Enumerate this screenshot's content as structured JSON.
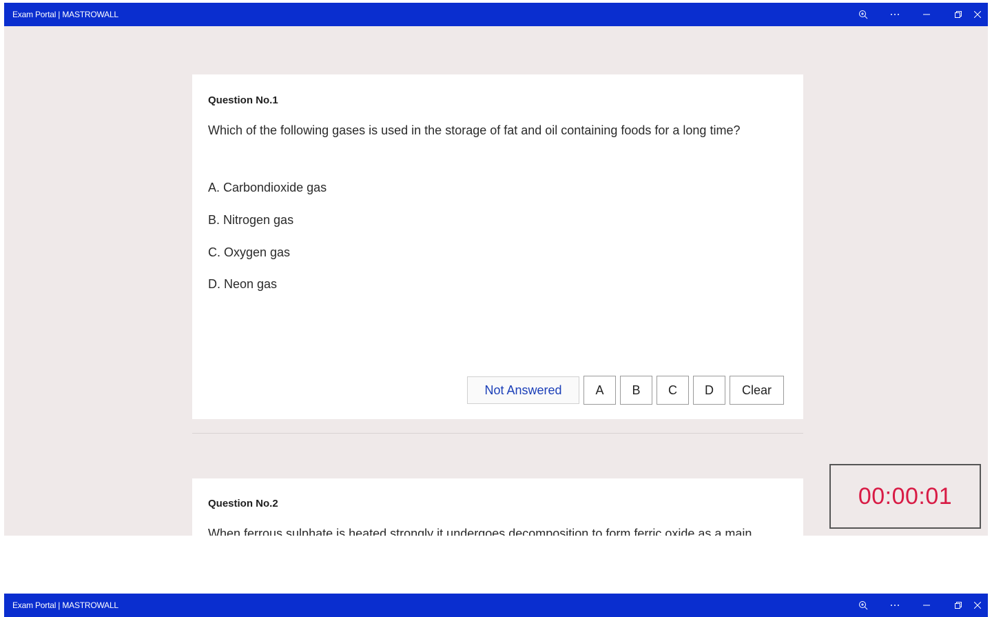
{
  "window": {
    "title": "Exam Portal | MASTROWALL",
    "controls": [
      "zoom-icon",
      "more-icon",
      "minimize-icon",
      "restore-icon",
      "close-icon"
    ]
  },
  "questions": [
    {
      "number_label": "Question No.1",
      "text": "Which of the following gases is used in the storage of fat and oil containing foods for a long time?",
      "options": [
        "A. Carbondioxide gas",
        "B. Nitrogen gas",
        "C. Oxygen gas",
        "D. Neon gas"
      ],
      "status": "Not Answered",
      "answer_buttons": [
        "A",
        "B",
        "C",
        "D"
      ],
      "clear_label": "Clear"
    },
    {
      "number_label": "Question No.2",
      "text": "When ferrous sulphate is heated strongly it undergoes decomposition to form ferric oxide as a main"
    }
  ],
  "timer": {
    "value": "00:00:01"
  },
  "colors": {
    "titlebar": "#0a2ecf",
    "background": "#efe9e9",
    "status_text": "#1b3fb8",
    "timer_text": "#d81b45"
  }
}
